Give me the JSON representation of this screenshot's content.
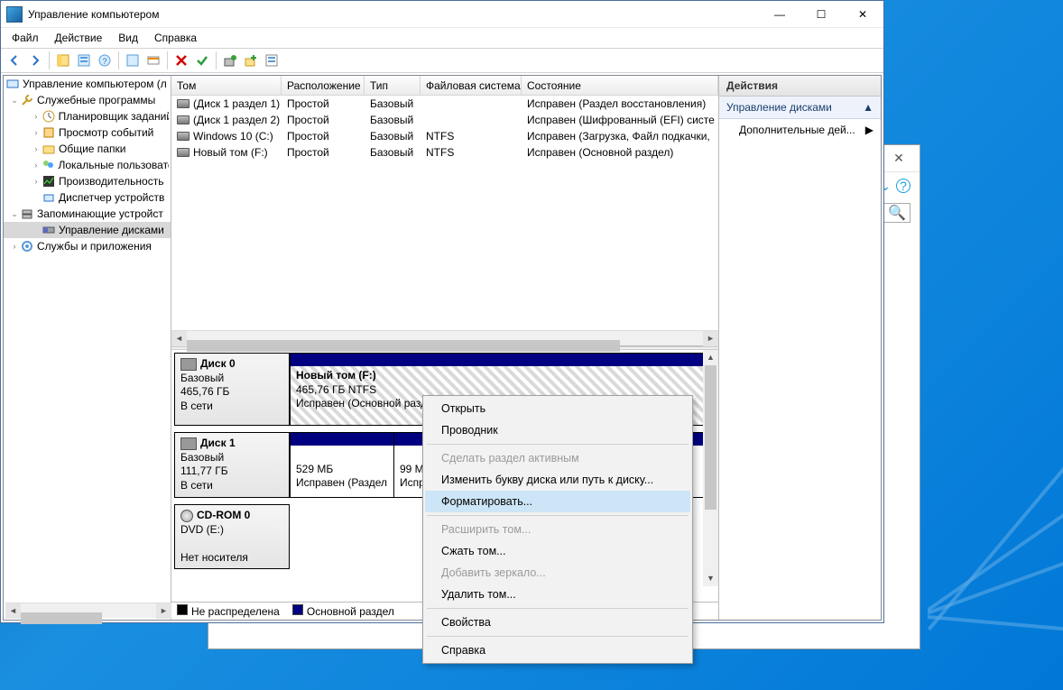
{
  "window": {
    "title": "Управление компьютером",
    "menu": [
      "Файл",
      "Действие",
      "Вид",
      "Справка"
    ],
    "winbtn": {
      "minimize": "—",
      "maximize": "☐",
      "close": "✕"
    }
  },
  "tree": {
    "root": "Управление компьютером (л",
    "system_tools": "Служебные программы",
    "task_scheduler": "Планировщик заданий",
    "event_viewer": "Просмотр событий",
    "shared_folders": "Общие папки",
    "local_users": "Локальные пользовате",
    "performance": "Производительность",
    "device_manager": "Диспетчер устройств",
    "storage": "Запоминающие устройст",
    "disk_mgmt": "Управление дисками",
    "services_apps": "Службы и приложения"
  },
  "columns": {
    "volume": "Том",
    "layout": "Расположение",
    "type": "Тип",
    "fs": "Файловая система",
    "status": "Состояние"
  },
  "rows": [
    {
      "vol": "(Диск 1 раздел 1)",
      "layout": "Простой",
      "type": "Базовый",
      "fs": "",
      "status": "Исправен (Раздел восстановления)"
    },
    {
      "vol": "(Диск 1 раздел 2)",
      "layout": "Простой",
      "type": "Базовый",
      "fs": "",
      "status": "Исправен (Шифрованный (EFI) систе"
    },
    {
      "vol": "Windows 10 (C:)",
      "layout": "Простой",
      "type": "Базовый",
      "fs": "NTFS",
      "status": "Исправен (Загрузка, Файл подкачки,"
    },
    {
      "vol": "Новый том (F:)",
      "layout": "Простой",
      "type": "Базовый",
      "fs": "NTFS",
      "status": "Исправен (Основной раздел)"
    }
  ],
  "actions": {
    "header": "Действия",
    "section": "Управление дисками",
    "more": "Дополнительные дей..."
  },
  "disks": {
    "d0": {
      "name": "Диск 0",
      "kind": "Базовый",
      "size": "465,76 ГБ",
      "state": "В сети",
      "p0_name": "Новый том  (F:)",
      "p0_size": "465,76 ГБ NTFS",
      "p0_status": "Исправен (Основной разде"
    },
    "d1": {
      "name": "Диск 1",
      "kind": "Базовый",
      "size": "111,77 ГБ",
      "state": "В сети",
      "p0_size": "529 МБ",
      "p0_status": "Исправен (Раздел",
      "p1_size": "99 МБ",
      "p1_status": "Испр"
    },
    "cd": {
      "name": "CD-ROM 0",
      "kind": "DVD (E:)",
      "state": "Нет носителя"
    }
  },
  "legend": {
    "unalloc": "Не распределена",
    "primary": "Основной раздел"
  },
  "ctx": {
    "open": "Открыть",
    "explorer": "Проводник",
    "make_active": "Сделать раздел активным",
    "change_letter": "Изменить букву диска или путь к диску...",
    "format": "Форматировать...",
    "extend": "Расширить том...",
    "shrink": "Сжать том...",
    "mirror": "Добавить зеркало...",
    "delete": "Удалить том...",
    "properties": "Свойства",
    "help": "Справка"
  },
  "bgpopup": {
    "close": "✕"
  }
}
